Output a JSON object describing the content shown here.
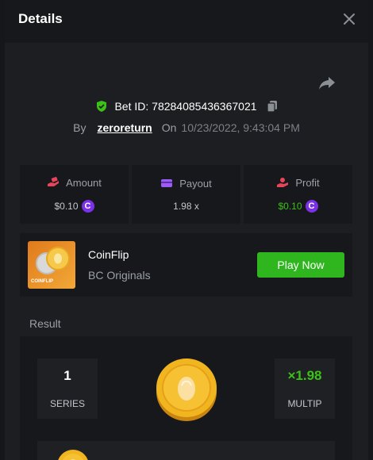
{
  "header": {
    "title": "Details"
  },
  "bet": {
    "id_text": "Bet ID: 78284085436367021"
  },
  "meta": {
    "by_label": "By",
    "username": "zeroreturn",
    "on_label": "On",
    "date": "10/23/2022, 9:43:04 PM"
  },
  "stats": [
    {
      "label": "Amount",
      "value": "$0.10",
      "icon": "amount-hand-icon",
      "color": "#e8455a",
      "coin": true,
      "green": false
    },
    {
      "label": "Payout",
      "value": "1.98 x",
      "icon": "payout-card-icon",
      "color": "#9b5cf6",
      "coin": false,
      "green": false
    },
    {
      "label": "Profit",
      "value": "$0.10",
      "icon": "profit-hand-icon",
      "color": "#e8455a",
      "coin": true,
      "green": true
    }
  ],
  "currency_symbol": "C",
  "game": {
    "name": "CoinFlip",
    "provider": "BC Originals",
    "thumb_label": "COINFLIP",
    "play_label": "Play Now"
  },
  "result": {
    "title": "Result",
    "series_value": "1",
    "series_label": "SERIES",
    "multiplier": "×1.98",
    "multiplier_label": "MULTIP"
  },
  "colors": {
    "accent_green": "#2fb51d",
    "profit_green": "#3bc117",
    "currency_purple": "#7b31e8"
  }
}
